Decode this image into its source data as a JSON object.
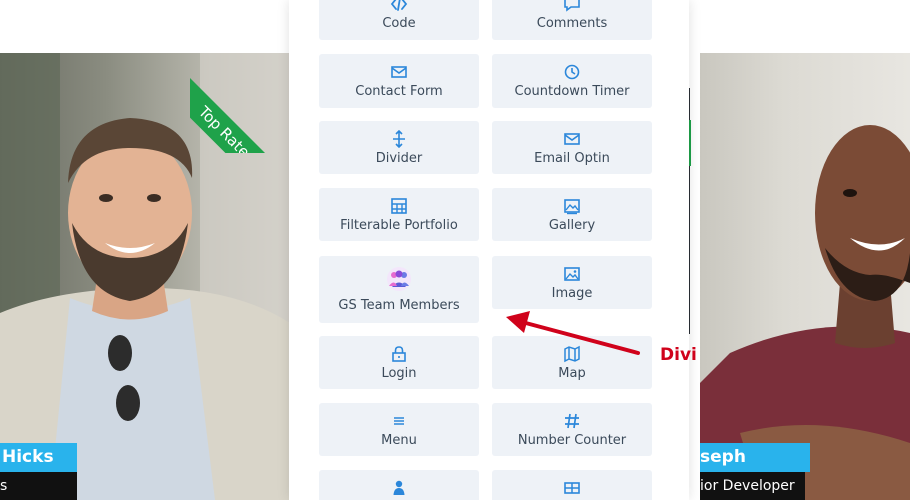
{
  "ribbon": {
    "label": "Top Rated"
  },
  "team": {
    "left": {
      "name": "Hicks",
      "role": "s Designer"
    },
    "right": {
      "name": "seph Barren",
      "role": "ior Developer"
    }
  },
  "annotation": {
    "text": "Divi"
  },
  "colors": {
    "accent": "#29b3ec",
    "ribbon": "#1fa24a",
    "icon": "#2b87da",
    "arrow": "#d0021b",
    "button_bg": "#eef2f7"
  },
  "modules": [
    {
      "label": "Code",
      "icon": "code-icon"
    },
    {
      "label": "Comments",
      "icon": "comments-icon"
    },
    {
      "label": "Contact Form",
      "icon": "envelope-icon"
    },
    {
      "label": "Countdown Timer",
      "icon": "timer-icon"
    },
    {
      "label": "Divider",
      "icon": "divider-icon"
    },
    {
      "label": "Email Optin",
      "icon": "envelope-icon"
    },
    {
      "label": "Filterable Portfolio",
      "icon": "grid-icon"
    },
    {
      "label": "Gallery",
      "icon": "gallery-icon"
    },
    {
      "label": "GS Team Members",
      "icon": "team-members-icon"
    },
    {
      "label": "Image",
      "icon": "image-icon"
    },
    {
      "label": "Login",
      "icon": "lock-icon"
    },
    {
      "label": "Map",
      "icon": "map-icon"
    },
    {
      "label": "Menu",
      "icon": "menu-icon"
    },
    {
      "label": "Number Counter",
      "icon": "hash-icon"
    },
    {
      "label": "",
      "icon": "person-icon"
    },
    {
      "label": "",
      "icon": "table-icon"
    }
  ]
}
